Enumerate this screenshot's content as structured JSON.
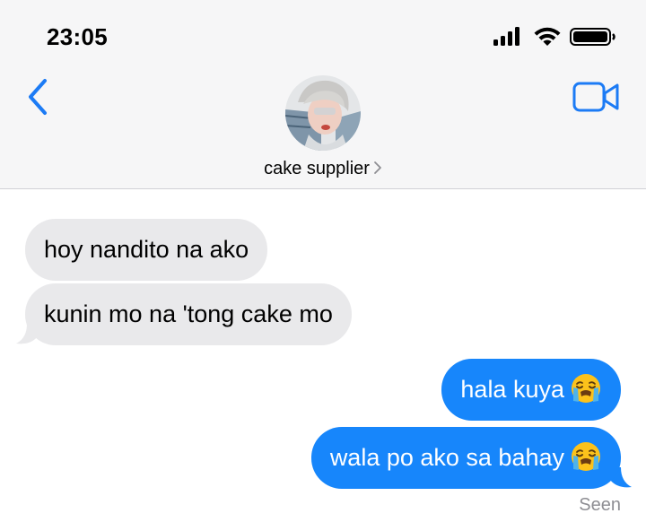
{
  "status_bar": {
    "time": "23:05",
    "icons": [
      "signal-icon",
      "wifi-icon",
      "battery-icon"
    ]
  },
  "header": {
    "back_icon": "chevron-left-icon",
    "video_icon": "video-camera-icon",
    "contact_name": "cake supplier",
    "accent_color": "#1c7bf5"
  },
  "messages": [
    {
      "direction": "received",
      "text": "hoy nandito na ako"
    },
    {
      "direction": "received",
      "text": "kunin mo na 'tong cake mo"
    },
    {
      "direction": "sent",
      "text": "hala kuya",
      "emoji": "loudly-crying-face"
    },
    {
      "direction": "sent",
      "text": "wala po ako sa bahay",
      "emoji": "loudly-crying-face"
    }
  ],
  "receipt": "Seen",
  "colors": {
    "sent_bubble": "#1786fb",
    "received_bubble": "#e9e9eb",
    "header_bg": "#f6f6f7"
  }
}
